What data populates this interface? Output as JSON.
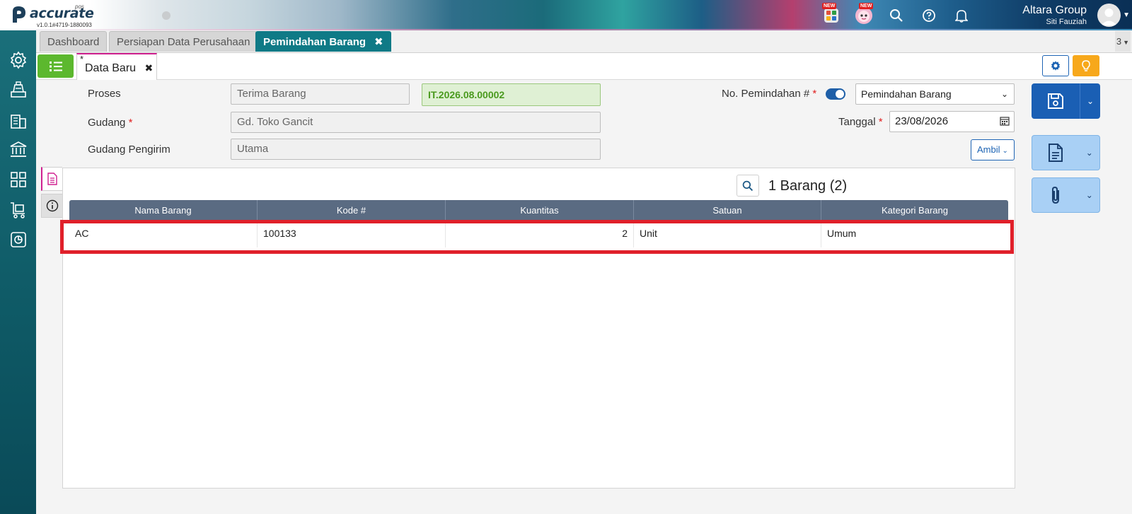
{
  "header": {
    "logo_text": "accurate",
    "logo_pos": "pos",
    "version": "v1.0.1#4719-1880093",
    "new_badge": "NEW",
    "company": "Altara Group",
    "user": "Siti Fauziah"
  },
  "tabs": {
    "dashboard": "Dashboard",
    "persiapan": "Persiapan Data Perusahaan",
    "pemindahan": "Pemindahan Barang",
    "close": "✖",
    "count": "3"
  },
  "subtab": {
    "star": "*",
    "label": "Data Baru",
    "close": "✖"
  },
  "form": {
    "proses_label": "Proses",
    "proses_value": "Terima Barang",
    "ref_number": "IT.2026.08.00002",
    "gudang_label": "Gudang",
    "gudang_value": "Gd. Toko Gancit",
    "pengirim_label": "Gudang Pengirim",
    "pengirim_value": "Utama",
    "no_label": "No. Pemindahan #",
    "no_select": "Pemindahan Barang",
    "tanggal_label": "Tanggal",
    "tanggal_value": "23/08/2026",
    "required_mark": "*",
    "ambil_label": "Ambil"
  },
  "table": {
    "count_text": "1 Barang (2)",
    "headers": [
      "Nama Barang",
      "Kode #",
      "Kuantitas",
      "Satuan",
      "Kategori Barang"
    ],
    "rows": [
      [
        "AC",
        "100133",
        "2",
        "Unit",
        "Umum"
      ]
    ]
  },
  "colors": {
    "accent_teal": "#0f7a86",
    "save_blue": "#1a5fb4",
    "highlight_red": "#e0202a",
    "green": "#5cb82e"
  }
}
